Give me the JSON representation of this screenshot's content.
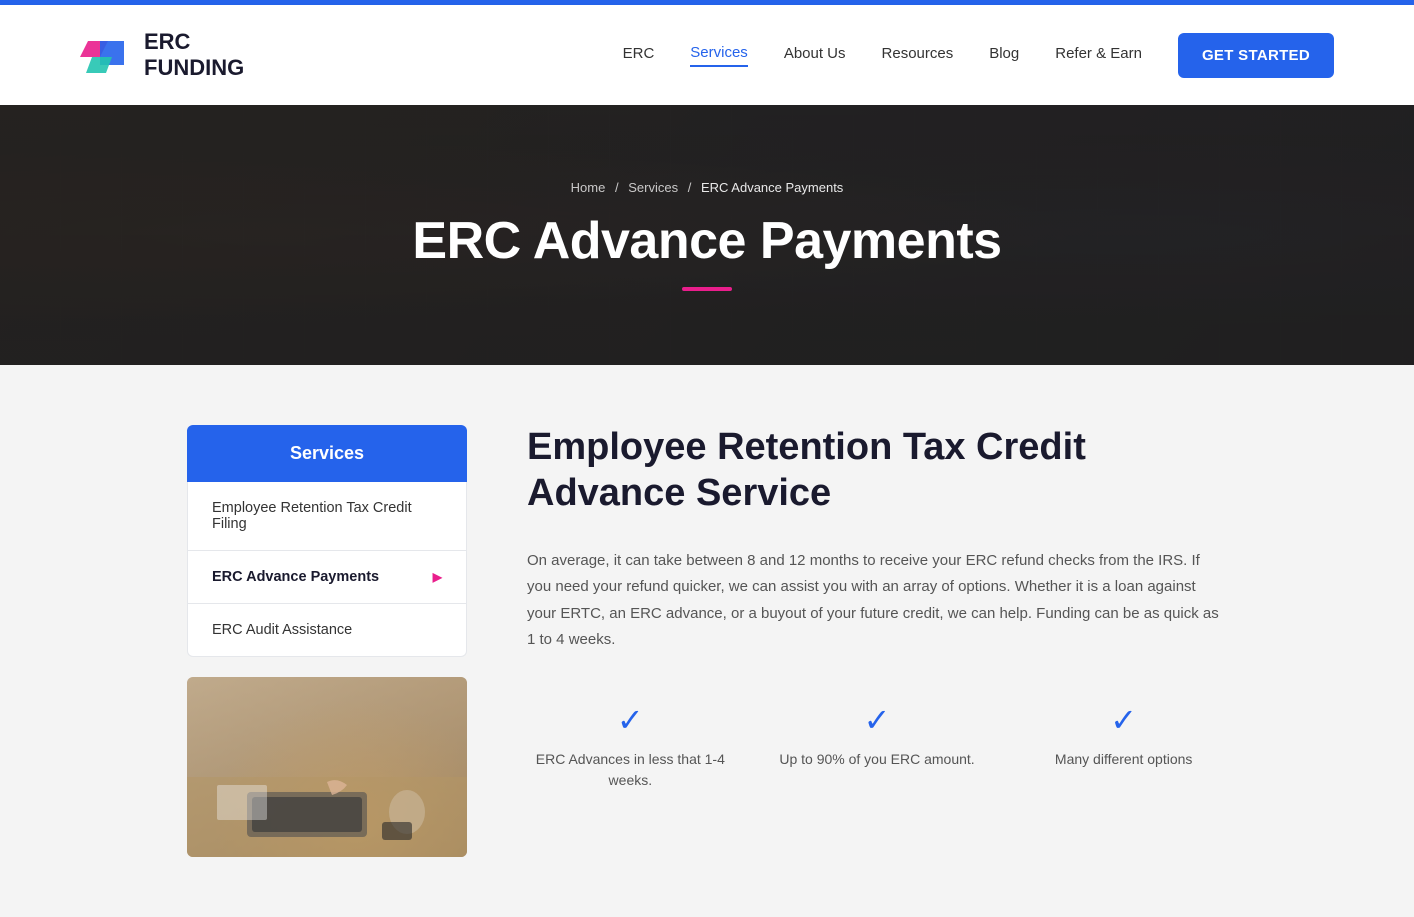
{
  "topbar": {},
  "header": {
    "logo_line1": "ERC",
    "logo_line2": "FUNDING",
    "nav": {
      "items": [
        {
          "label": "ERC",
          "id": "erc",
          "active": false
        },
        {
          "label": "Services",
          "id": "services",
          "active": true
        },
        {
          "label": "About Us",
          "id": "about",
          "active": false
        },
        {
          "label": "Resources",
          "id": "resources",
          "active": false
        },
        {
          "label": "Blog",
          "id": "blog",
          "active": false
        },
        {
          "label": "Refer & Earn",
          "id": "refer",
          "active": false
        }
      ],
      "cta": "GET STARTED"
    }
  },
  "hero": {
    "breadcrumb": {
      "home": "Home",
      "services": "Services",
      "current": "ERC Advance Payments"
    },
    "title": "ERC Advance Payments"
  },
  "sidebar": {
    "title": "Services",
    "items": [
      {
        "label": "Employee Retention Tax Credit Filing",
        "active": false,
        "has_arrow": false
      },
      {
        "label": "ERC Advance Payments",
        "active": true,
        "has_arrow": true
      },
      {
        "label": "ERC Audit Assistance",
        "active": false,
        "has_arrow": false
      }
    ]
  },
  "content": {
    "title": "Employee Retention Tax Credit Advance Service",
    "body": "On average, it can take between 8 and 12 months to receive your ERC refund checks from the IRS. If you need your refund quicker, we can assist you with an array of options. Whether it is a loan against your ERTC, an ERC advance, or a buyout of your future credit, we can help. Funding can be as quick as 1 to 4 weeks.",
    "features": [
      {
        "check": "✓",
        "label": "ERC Advances in less that 1-4 weeks."
      },
      {
        "check": "✓",
        "label": "Up to 90% of you ERC amount."
      },
      {
        "check": "✓",
        "label": "Many different options"
      }
    ]
  }
}
